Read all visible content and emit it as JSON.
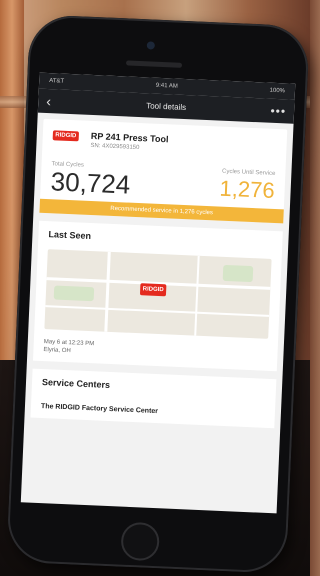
{
  "status_bar": {
    "carrier": "AT&T",
    "time": "9:41 AM",
    "battery": "100%"
  },
  "nav": {
    "back_icon": "chevron-left-icon",
    "title": "Tool details",
    "more_icon": "more-icon"
  },
  "tool": {
    "brand": "RIDGID",
    "name": "RP 241 Press Tool",
    "serial": "SN: 4X029593150"
  },
  "stats": {
    "total_label": "Total Cycles",
    "total_value": "30,724",
    "service_label": "Cycles Until Service",
    "service_value": "1,276"
  },
  "banner": {
    "text": "Recommended service in 1,276 cycles"
  },
  "last_seen": {
    "title": "Last Seen",
    "map_pin": "RIDGID",
    "time": "May 6 at 12:23 PM",
    "place": "Elyria, OH"
  },
  "service_centers": {
    "title": "Service Centers",
    "first_item": "The RIDGID Factory Service Center"
  },
  "colors": {
    "accent": "#f3b63a",
    "brand": "#e42a1e",
    "bar": "#1d1f23"
  }
}
